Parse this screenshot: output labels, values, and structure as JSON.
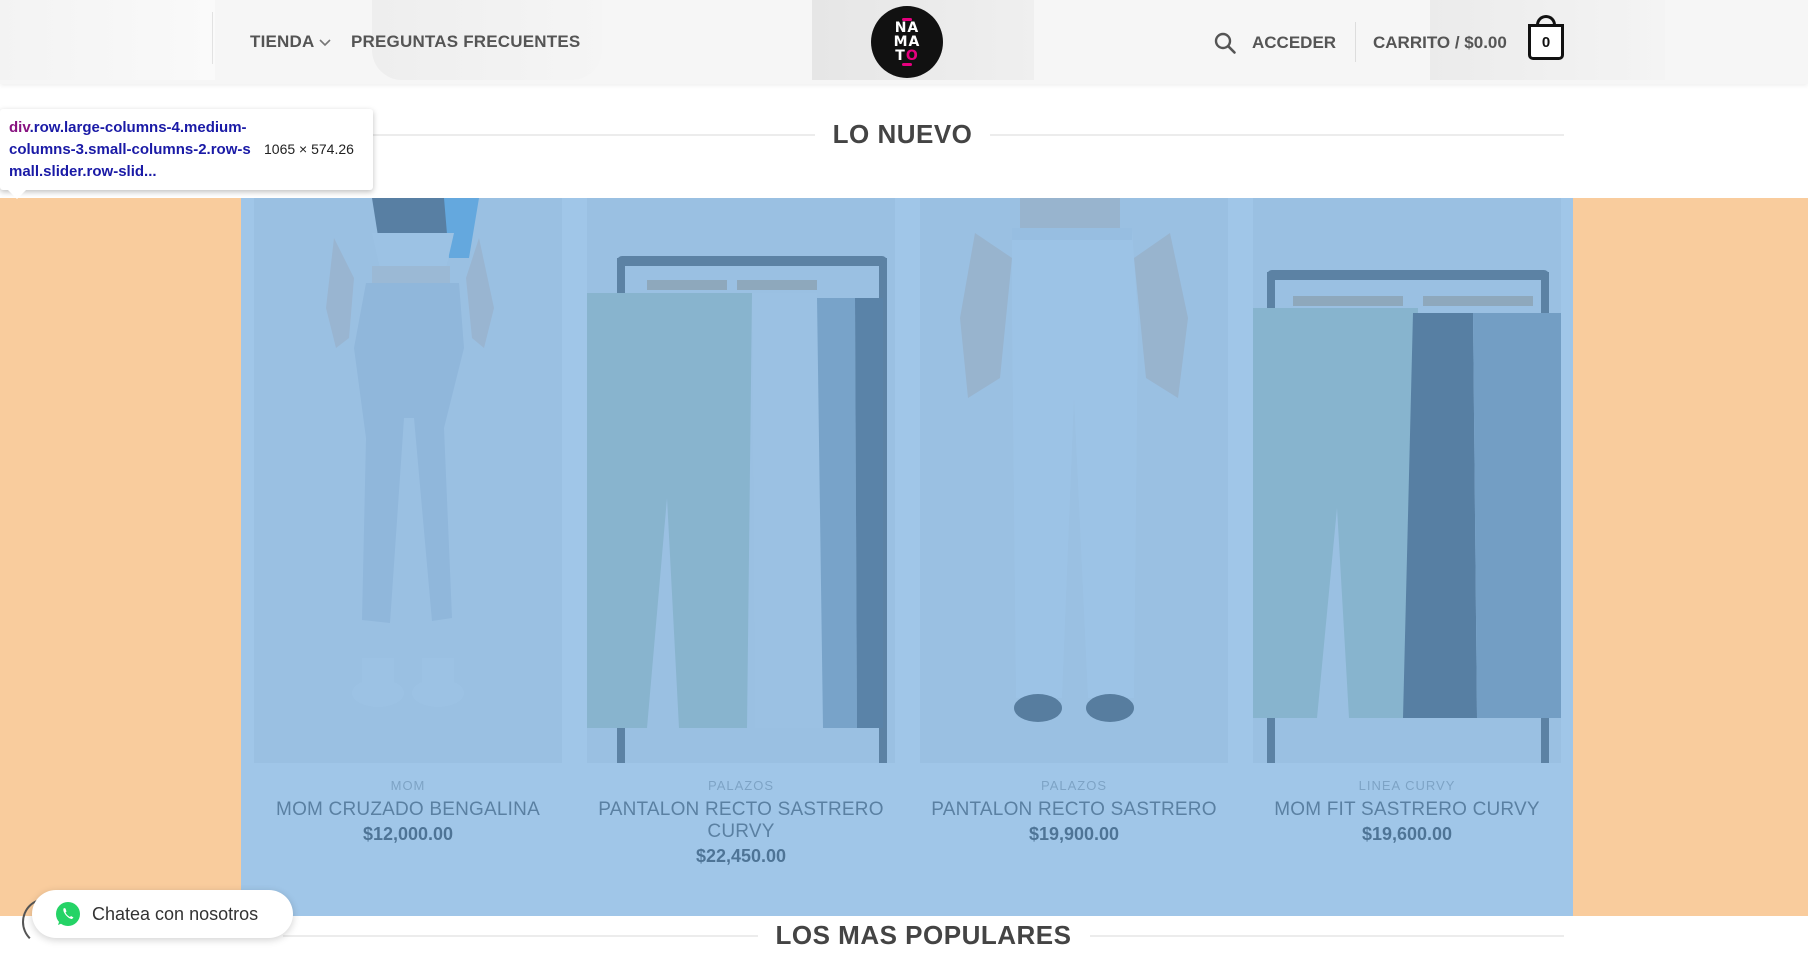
{
  "nav": {
    "shop_label": "TIENDA",
    "faq_label": "PREGUNTAS FRECUENTES",
    "login_label": "ACCEDER",
    "cart_label": "CARRITO / $0.00",
    "cart_count": "0"
  },
  "logo": {
    "line1": "NA",
    "line2": "MA",
    "line3": "T",
    "dot": "O"
  },
  "sections": {
    "new_title": "LO NUEVO",
    "popular_title": "LOS MAS POPULARES"
  },
  "inspector": {
    "tag": "div",
    "selector": ".row.large-columns-4.medium-columns-3.small-columns-2.row-small.slider.row-slid...",
    "dimensions": "1065 × 574.26"
  },
  "products": [
    {
      "category": "MOM",
      "name": "MOM CRUZADO BENGALINA",
      "price": "$12,000.00"
    },
    {
      "category": "PALAZOS",
      "name": "PANTALON RECTO SASTRERO CURVY",
      "price": "$22,450.00"
    },
    {
      "category": "PALAZOS",
      "name": "PANTALON RECTO SASTRERO",
      "price": "$19,900.00"
    },
    {
      "category": "LINEA CURVY",
      "name": "MOM FIT SASTRERO CURVY",
      "price": "$19,600.00"
    }
  ],
  "chat": {
    "label": "Chatea con nosotros"
  },
  "colors": {
    "padding_overlay": "#f6b26b",
    "content_overlay": "#6fa8dc",
    "brand_pink": "#e6007e",
    "whatsapp_green": "#25d366"
  }
}
